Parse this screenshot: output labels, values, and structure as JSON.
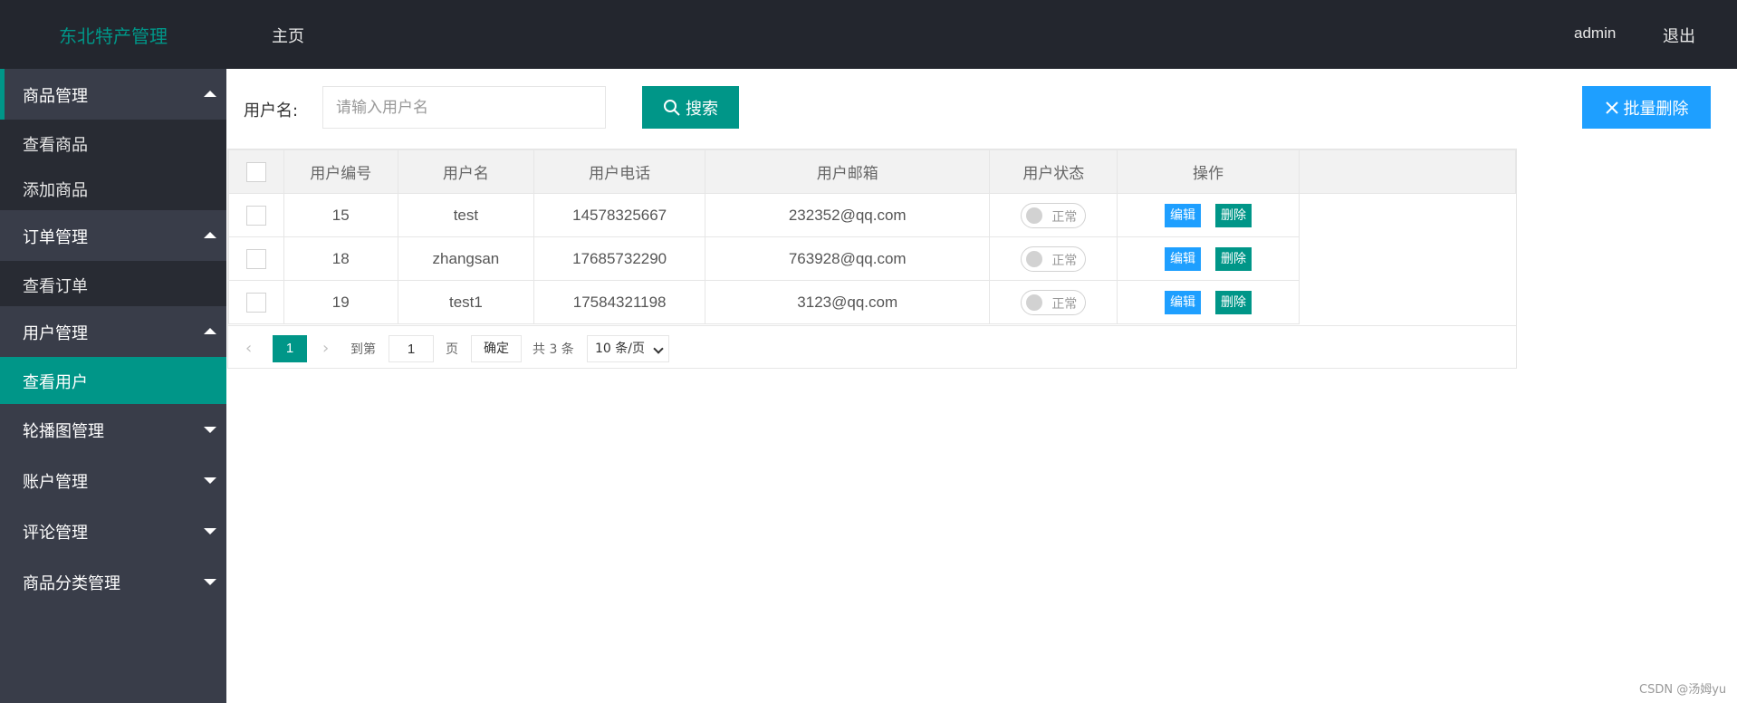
{
  "header": {
    "brand": "东北特产管理",
    "home": "主页",
    "user": "admin",
    "logout": "退出"
  },
  "sidebar": {
    "groups": [
      {
        "title": "商品管理",
        "expanded": true,
        "items": [
          "查看商品",
          "添加商品"
        ]
      },
      {
        "title": "订单管理",
        "expanded": true,
        "items": [
          "查看订单"
        ]
      },
      {
        "title": "用户管理",
        "expanded": true,
        "items": [
          "查看用户"
        ],
        "selected": "查看用户"
      },
      {
        "title": "轮播图管理",
        "expanded": false
      },
      {
        "title": "账户管理",
        "expanded": false
      },
      {
        "title": "评论管理",
        "expanded": false
      },
      {
        "title": "商品分类管理",
        "expanded": false
      }
    ]
  },
  "toolbar": {
    "username_label": "用户名:",
    "search_placeholder": "请输入用户名",
    "search_button": "搜索",
    "batch_delete_button": "批量删除"
  },
  "table": {
    "columns": [
      "用户编号",
      "用户名",
      "用户电话",
      "用户邮箱",
      "用户状态",
      "操作"
    ],
    "rows": [
      {
        "id": "15",
        "name": "test",
        "phone": "14578325667",
        "email": "232352@qq.com",
        "status": "正常"
      },
      {
        "id": "18",
        "name": "zhangsan",
        "phone": "17685732290",
        "email": "763928@qq.com",
        "status": "正常"
      },
      {
        "id": "19",
        "name": "test1",
        "phone": "17584321198",
        "email": "3123@qq.com",
        "status": "正常"
      }
    ],
    "edit_label": "编辑",
    "delete_label": "删除"
  },
  "pager": {
    "current_page": "1",
    "goto_label": "到第",
    "goto_value": "1",
    "page_label": "页",
    "confirm_label": "确定",
    "total_label": "共 3 条",
    "page_size": "10 条/页"
  },
  "watermark": "CSDN @汤姆yu",
  "colors": {
    "header_bg": "#23262e",
    "sidebar_bg": "#393d49",
    "submenu_bg": "#282b33",
    "accent_green": "#009688",
    "accent_blue": "#1e9fff"
  }
}
